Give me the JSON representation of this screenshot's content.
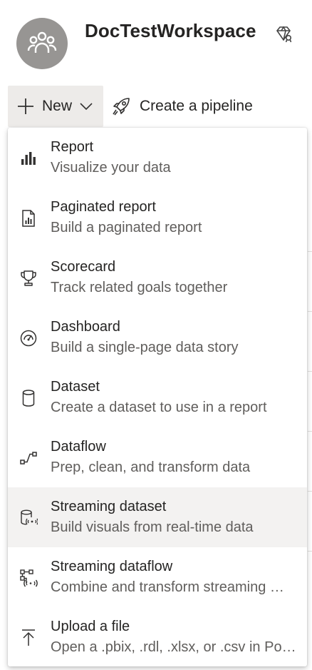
{
  "workspace": {
    "name": "DocTestWorkspace",
    "avatar_icon": "people-group-icon",
    "badge_icon": "premium-diamond-icon"
  },
  "toolbar": {
    "new_label": "New",
    "new_icon": "plus-icon",
    "new_chevron_icon": "chevron-down-icon",
    "pipeline_label": "Create a pipeline",
    "pipeline_icon": "rocket-icon"
  },
  "menu": {
    "items": [
      {
        "title": "Report",
        "description": "Visualize your data",
        "icon": "bar-chart-icon"
      },
      {
        "title": "Paginated report",
        "description": "Build a paginated report",
        "icon": "paginated-report-icon"
      },
      {
        "title": "Scorecard",
        "description": "Track related goals together",
        "icon": "trophy-icon"
      },
      {
        "title": "Dashboard",
        "description": "Build a single-page data story",
        "icon": "gauge-icon"
      },
      {
        "title": "Dataset",
        "description": "Create a dataset to use in a report",
        "icon": "database-icon"
      },
      {
        "title": "Dataflow",
        "description": "Prep, clean, and transform data",
        "icon": "dataflow-icon"
      },
      {
        "title": "Streaming dataset",
        "description": "Build visuals from real-time data",
        "icon": "streaming-database-icon"
      },
      {
        "title": "Streaming dataflow",
        "description": "Combine and transform streaming …",
        "icon": "streaming-dataflow-icon"
      },
      {
        "title": "Upload a file",
        "description": "Open a .pbix, .rdl, .xlsx, or .csv in Po…",
        "icon": "upload-icon"
      }
    ],
    "highlighted_index": 6
  },
  "colors": {
    "accent_gray": "#979593",
    "button_bg": "#edebe9",
    "hover_bg": "#f3f2f1",
    "text_primary": "#252423",
    "text_secondary": "#605e5c"
  }
}
